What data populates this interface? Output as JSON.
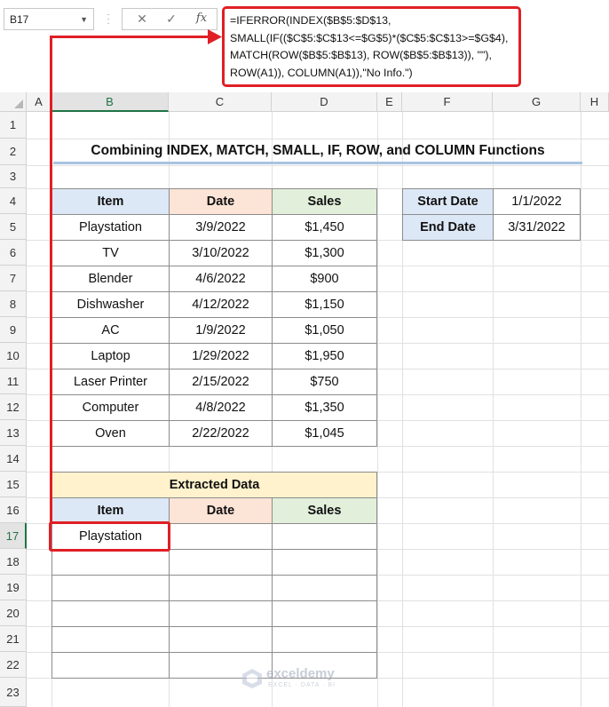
{
  "formula_bar": {
    "name_box": "B17",
    "cancel_icon": "✕",
    "enter_icon": "✓",
    "fx_label": "fx",
    "formula_lines": [
      "=IFERROR(INDEX($B$5:$D$13,",
      "SMALL(IF(($C$5:$C$13<=$G$5)*($C$5:$C$13>=$G$4),",
      "MATCH(ROW($B$5:$B$13), ROW($B$5:$B$13)), \"\"),",
      "ROW(A1)), COLUMN(A1)),\"No Info.\")"
    ]
  },
  "columns": [
    "A",
    "B",
    "C",
    "D",
    "E",
    "F",
    "G",
    "H"
  ],
  "rows": [
    "1",
    "2",
    "3",
    "4",
    "5",
    "6",
    "7",
    "8",
    "9",
    "10",
    "11",
    "12",
    "13",
    "14",
    "15",
    "16",
    "17",
    "18",
    "19",
    "20",
    "21",
    "22",
    "23"
  ],
  "selected_cell": "B17",
  "title": "Combining INDEX, MATCH, SMALL, IF, ROW, and COLUMN Functions",
  "main_table": {
    "headers": [
      "Item",
      "Date",
      "Sales"
    ],
    "rows": [
      [
        "Playstation",
        "3/9/2022",
        "$1,450"
      ],
      [
        "TV",
        "3/10/2022",
        "$1,300"
      ],
      [
        "Blender",
        "4/6/2022",
        "$900"
      ],
      [
        "Dishwasher",
        "4/12/2022",
        "$1,150"
      ],
      [
        "AC",
        "1/9/2022",
        "$1,050"
      ],
      [
        "Laptop",
        "1/29/2022",
        "$1,950"
      ],
      [
        "Laser Printer",
        "2/15/2022",
        "$750"
      ],
      [
        "Computer",
        "4/8/2022",
        "$1,350"
      ],
      [
        "Oven",
        "2/22/2022",
        "$1,045"
      ]
    ]
  },
  "criteria": {
    "start_label": "Start Date",
    "start_value": "1/1/2022",
    "end_label": "End Date",
    "end_value": "3/31/2022"
  },
  "extracted": {
    "title": "Extracted Data",
    "headers": [
      "Item",
      "Date",
      "Sales"
    ],
    "first_item": "Playstation"
  },
  "watermark": {
    "name": "exceldemy",
    "tagline": "EXCEL · DATA · BI"
  },
  "colors": {
    "highlight_red": "#e01f26",
    "item_header": "#dde8f6",
    "date_header": "#fce4d6",
    "sales_header": "#e2efda",
    "extracted_header": "#fff2cc",
    "excel_green": "#217346"
  }
}
